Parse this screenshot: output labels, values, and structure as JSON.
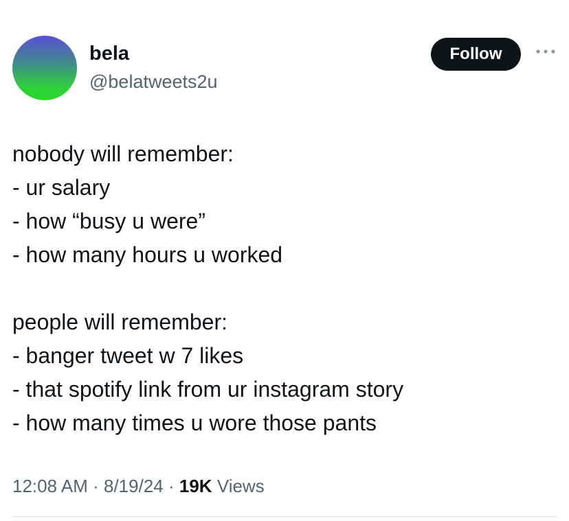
{
  "author": {
    "display_name": "bela",
    "handle": "@belatweets2u",
    "avatar_icon": "gradient-avatar"
  },
  "header": {
    "follow_label": "Follow",
    "more_icon": "ellipsis-icon"
  },
  "tweet": {
    "lines": [
      "nobody will remember:",
      "- ur salary",
      "- how “busy u were”",
      "- how many hours u worked",
      "",
      "people will remember:",
      "- banger tweet w 7 likes",
      "- that spotify link from ur instagram story",
      "- how many times u wore those pants"
    ]
  },
  "meta": {
    "time": "12:08 AM",
    "separator": "·",
    "date": "8/19/24",
    "views_count": "19K",
    "views_label": "Views"
  },
  "colors": {
    "text": "#0f1419",
    "secondary": "#536471",
    "button_bg": "#0f1419",
    "button_text": "#ffffff",
    "divider": "#dfe3e6",
    "avatar_top": "#5a4fd6",
    "avatar_bottom": "#29d628"
  }
}
